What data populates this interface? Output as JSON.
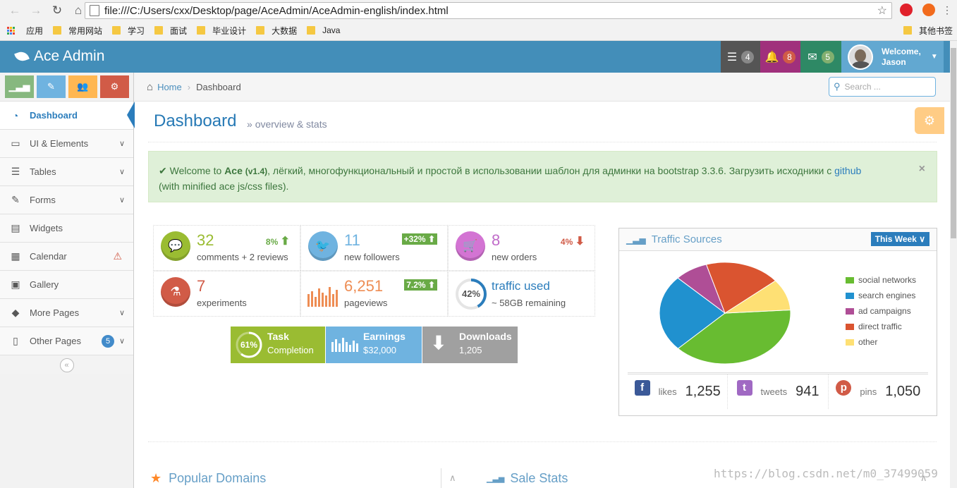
{
  "browser": {
    "url": "file:///C:/Users/cxx/Desktop/page/AceAdmin/AceAdmin-english/index.html",
    "bookmarks": [
      "应用",
      "常用网站",
      "学习",
      "面试",
      "毕业设计",
      "大数据",
      "Java"
    ],
    "other_bookmarks": "其他书签"
  },
  "navbar": {
    "brand": "Ace Admin",
    "tasks_count": "4",
    "notifications_count": "8",
    "messages_count": "5",
    "welcome": "Welcome,",
    "user": "Jason"
  },
  "sidebar": {
    "items": [
      {
        "label": "Dashboard"
      },
      {
        "label": "UI & Elements"
      },
      {
        "label": "Tables"
      },
      {
        "label": "Forms"
      },
      {
        "label": "Widgets"
      },
      {
        "label": "Calendar"
      },
      {
        "label": "Gallery"
      },
      {
        "label": "More Pages"
      },
      {
        "label": "Other Pages",
        "badge": "5"
      }
    ]
  },
  "breadcrumb": {
    "home": "Home",
    "current": "Dashboard"
  },
  "search": {
    "placeholder": "Search ..."
  },
  "page": {
    "title": "Dashboard",
    "subtitle": "overview & stats"
  },
  "alert": {
    "lead": "Welcome to",
    "brand": "Ace",
    "version": "(v1.4)",
    "text": ", лёгкий, многофункциональный и простой в использовании шаблон для админки на bootstrap 3.3.6. Загрузить исходники с",
    "link": "github",
    "tail": "(with minified ace js/css files)."
  },
  "infoboxes": [
    {
      "num": "32",
      "text": "comments + 2 reviews",
      "stat": "8%"
    },
    {
      "num": "11",
      "text": "new followers",
      "stat": "+32%"
    },
    {
      "num": "8",
      "text": "new orders",
      "stat": "4%"
    },
    {
      "num": "7",
      "text": "experiments"
    },
    {
      "num": "6,251",
      "text": "pageviews",
      "stat": "7.2%"
    },
    {
      "percent": "42%",
      "num": "traffic used",
      "text": "~ 58GB remaining"
    }
  ],
  "boxes": [
    {
      "percent": "61%",
      "title": "Task",
      "sub": "Completion"
    },
    {
      "title": "Earnings",
      "sub": "$32,000"
    },
    {
      "title": "Downloads",
      "sub": "1,205"
    }
  ],
  "widget": {
    "title": "Traffic Sources",
    "range": "This Week",
    "legend": [
      "social networks",
      "search engines",
      "ad campaigns",
      "direct traffic",
      "other"
    ],
    "social": [
      {
        "label": "likes",
        "value": "1,255"
      },
      {
        "label": "tweets",
        "value": "941"
      },
      {
        "label": "pins",
        "value": "1,050"
      }
    ]
  },
  "chart_data": {
    "type": "pie",
    "categories": [
      "social networks",
      "search engines",
      "ad campaigns",
      "direct traffic",
      "other"
    ],
    "values": [
      38.7,
      24.5,
      8.2,
      18.6,
      10
    ],
    "colors": [
      "#68BC31",
      "#2091CF",
      "#AF4E96",
      "#DA5430",
      "#FEE074"
    ]
  },
  "bottom": {
    "popular": "Popular Domains",
    "sale": "Sale Stats"
  },
  "watermark": "https://blog.csdn.net/m0_37499059"
}
